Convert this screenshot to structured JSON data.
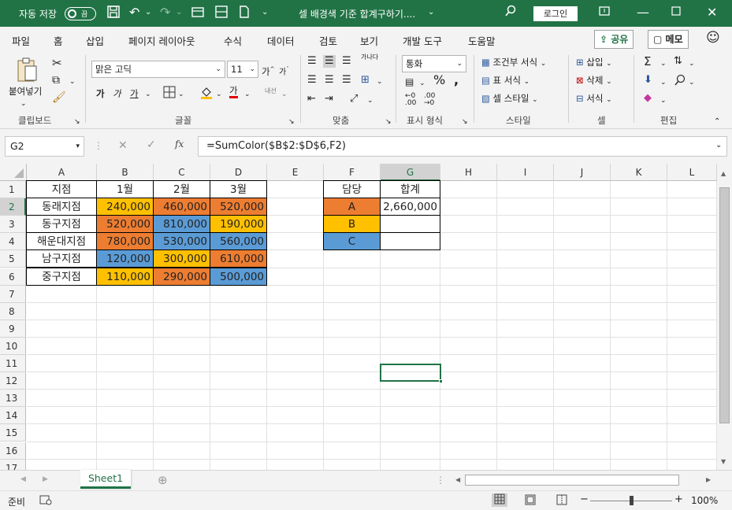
{
  "titlebar": {
    "autosave_label": "자동 저장",
    "autosave_state": "끔",
    "doc_title": "셀 배경색 기준 합계구하기....",
    "login_label": "로그인"
  },
  "menu": {
    "items": [
      "파일",
      "홈",
      "삽입",
      "페이지 레이아웃",
      "수식",
      "데이터",
      "검토",
      "보기",
      "개발 도구",
      "도움말"
    ],
    "share_label": "공유",
    "memo_label": "메모"
  },
  "ribbon": {
    "paste_label": "붙여넣기",
    "clipboard_group": "클립보드",
    "font_name": "맑은 고딕",
    "font_size": "11",
    "bold_glyph": "가",
    "italic_glyph": "가",
    "underline_glyph": "가",
    "font_color_glyph": "가",
    "phonetic_label": "내선",
    "font_group": "글꼴",
    "wrap_label": "가나다",
    "align_group": "맞춤",
    "number_format": "통화",
    "number_group": "표시 형식",
    "conditional_label": "조건부 서식",
    "table_format_label": "표 서식",
    "cell_style_label": "셀 스타일",
    "style_group": "스타일",
    "insert_label": "삽입",
    "delete_label": "삭제",
    "format_label": "서식",
    "cells_group": "셀",
    "edit_group": "편집"
  },
  "formula_bar": {
    "name_box": "G2",
    "formula": "=SumColor($B$2:$D$6,F2)"
  },
  "colors": {
    "orange": "#ed7d31",
    "yellow": "#ffc000",
    "blue": "#5b9bd5",
    "excel_green": "#217346"
  },
  "sheet": {
    "columns": [
      "A",
      "B",
      "C",
      "D",
      "E",
      "F",
      "G",
      "H",
      "I",
      "J",
      "K",
      "L"
    ],
    "rows": [
      "1",
      "2",
      "3",
      "4",
      "5",
      "6",
      "7",
      "8",
      "9",
      "10",
      "11",
      "12",
      "13",
      "14",
      "15",
      "16",
      "17"
    ],
    "table": {
      "headers": [
        "지점",
        "1월",
        "2월",
        "3월"
      ],
      "rows": [
        {
          "name": "동래지점",
          "values": [
            "240,000",
            "460,000",
            "520,000"
          ],
          "colors": [
            "yellow",
            "orange",
            "orange"
          ]
        },
        {
          "name": "동구지점",
          "values": [
            "520,000",
            "810,000",
            "190,000"
          ],
          "colors": [
            "orange",
            "blue",
            "yellow"
          ]
        },
        {
          "name": "해운대지점",
          "values": [
            "780,000",
            "530,000",
            "560,000"
          ],
          "colors": [
            "orange",
            "blue",
            "blue"
          ]
        },
        {
          "name": "남구지점",
          "values": [
            "120,000",
            "300,000",
            "610,000"
          ],
          "colors": [
            "blue",
            "yellow",
            "orange"
          ]
        },
        {
          "name": "중구지점",
          "values": [
            "110,000",
            "290,000",
            "500,000"
          ],
          "colors": [
            "yellow",
            "orange",
            "blue"
          ]
        }
      ]
    },
    "summary": {
      "headers": [
        "담당",
        "합계"
      ],
      "rows": [
        {
          "label": "A",
          "color": "orange",
          "total": "2,660,000"
        },
        {
          "label": "B",
          "color": "yellow",
          "total": ""
        },
        {
          "label": "C",
          "color": "blue",
          "total": ""
        }
      ]
    }
  },
  "tabs": {
    "active_sheet": "Sheet1"
  },
  "status": {
    "ready": "준비",
    "zoom": "100%"
  }
}
